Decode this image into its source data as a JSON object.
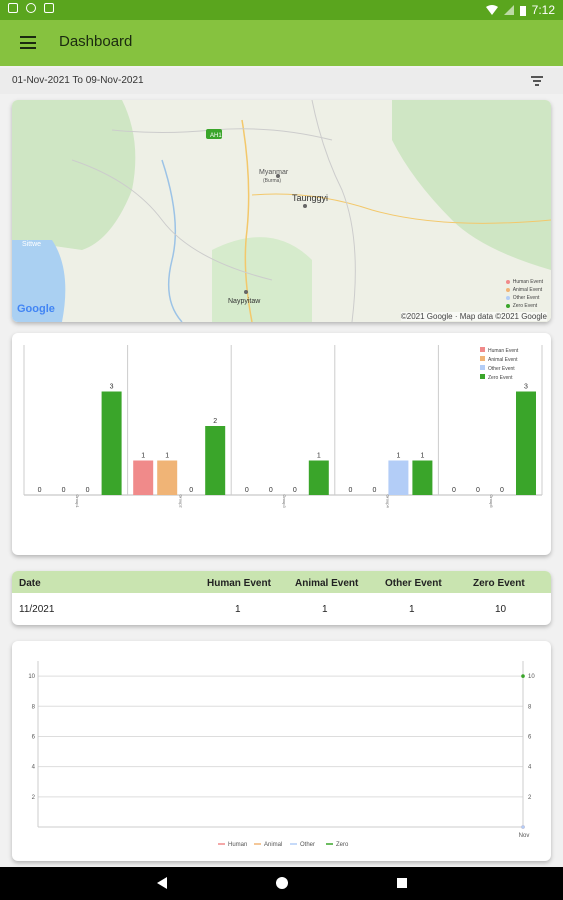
{
  "status_bar": {
    "time": "7:12"
  },
  "app_bar": {
    "title": "Dashboard"
  },
  "date_filter": {
    "range": "01-Nov-2021 To 09-Nov-2021"
  },
  "map": {
    "labels": [
      {
        "text": "Myanmar"
      },
      {
        "text": "(Burma)"
      },
      {
        "text": "Taunggyi"
      },
      {
        "text": "Naypyitaw"
      },
      {
        "text": "Sittwe"
      },
      {
        "text": "AH1"
      }
    ],
    "legend": [
      "Human Event",
      "Animal Event",
      "Other Event",
      "Zero Event"
    ],
    "attribution": "©2021 Google · Map data ©2021 Google",
    "logo": "Google"
  },
  "colors": {
    "human": "#f08a8a",
    "animal": "#f0b476",
    "other": "#b3cdf7",
    "zero": "#3aa52a",
    "accent": "#86c23f",
    "status": "#5aa51e"
  },
  "chart_data": [
    {
      "type": "bar",
      "categories": [
        "Group1",
        "Group2",
        "Group3",
        "Group4",
        "Group5"
      ],
      "series": [
        {
          "name": "Human Event",
          "values": [
            0,
            1,
            0,
            0,
            0
          ]
        },
        {
          "name": "Animal Event",
          "values": [
            0,
            1,
            0,
            0,
            0
          ]
        },
        {
          "name": "Other Event",
          "values": [
            0,
            0,
            0,
            1,
            0
          ]
        },
        {
          "name": "Zero Event",
          "values": [
            3,
            2,
            1,
            1,
            3
          ]
        }
      ],
      "ylim": [
        0,
        4
      ],
      "legend": "top-right"
    },
    {
      "type": "line",
      "x": [
        "Nov"
      ],
      "series": [
        {
          "name": "Human",
          "values": [
            0
          ]
        },
        {
          "name": "Animal",
          "values": [
            0
          ]
        },
        {
          "name": "Other",
          "values": [
            0
          ]
        },
        {
          "name": "Zero",
          "values": [
            10
          ]
        }
      ],
      "yticks": [
        "2",
        "4",
        "6",
        "8",
        "10"
      ],
      "ylim": [
        0,
        11
      ],
      "grid": true,
      "legend": "bottom"
    }
  ],
  "table": {
    "headers": [
      "Date",
      "Human Event",
      "Animal Event",
      "Other Event",
      "Zero Event"
    ],
    "rows": [
      [
        "11/2021",
        "1",
        "1",
        "1",
        "10"
      ]
    ]
  }
}
